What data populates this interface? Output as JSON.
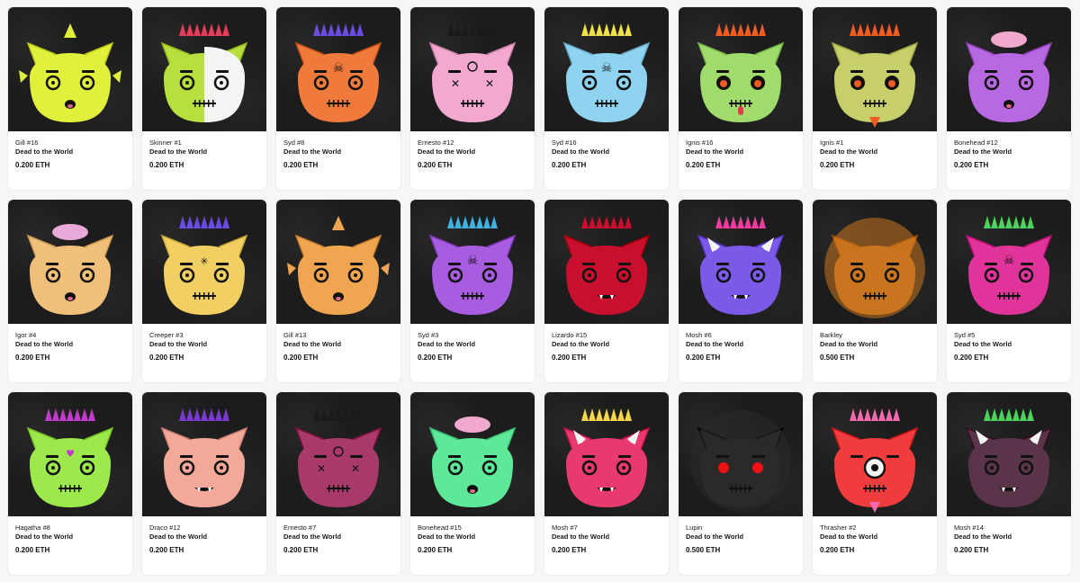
{
  "collection": "Dead to the World",
  "items": [
    {
      "name": "Gill #16",
      "collection": "Dead to the World",
      "price": "0.200 ETH",
      "face": "#e1f03a",
      "hair": "#e1f03a",
      "eye": "plain",
      "feature": "fish",
      "icon": "monster-face-icon"
    },
    {
      "name": "Skinner #1",
      "collection": "Dead to the World",
      "price": "0.200 ETH",
      "face": "#b7df3d",
      "hair": "#e23d5d",
      "eye": "plain",
      "feature": "skull-half",
      "icon": "monster-face-icon"
    },
    {
      "name": "Syd #8",
      "collection": "Dead to the World",
      "price": "0.200 ETH",
      "face": "#f07a3c",
      "hair": "#6b4be0",
      "eye": "plain",
      "feature": "crossbones",
      "icon": "monster-face-icon"
    },
    {
      "name": "Ernesto #12",
      "collection": "Dead to the World",
      "price": "0.200 ETH",
      "face": "#f2a8cf",
      "hair": "#1a1a1a",
      "eye": "x",
      "feature": "pentagram",
      "icon": "monster-face-icon"
    },
    {
      "name": "Syd #16",
      "collection": "Dead to the World",
      "price": "0.200 ETH",
      "face": "#8fd3f0",
      "hair": "#f0e04a",
      "eye": "plain",
      "feature": "crossbones",
      "icon": "monster-face-icon"
    },
    {
      "name": "Ignis #16",
      "collection": "Dead to the World",
      "price": "0.200 ETH",
      "face": "#9fdc6b",
      "hair": "#f05a23",
      "eye": "fire",
      "feature": "tongue",
      "icon": "monster-face-icon"
    },
    {
      "name": "Ignis #1",
      "collection": "Dead to the World",
      "price": "0.200 ETH",
      "face": "#c7cf6a",
      "hair": "#f05a23",
      "eye": "fire",
      "feature": "goatee",
      "icon": "monster-face-icon"
    },
    {
      "name": "Bonehead #12",
      "collection": "Dead to the World",
      "price": "0.200 ETH",
      "face": "#b868e0",
      "hair": "#f0a8cf",
      "eye": "plain",
      "feature": "brain",
      "icon": "monster-face-icon"
    },
    {
      "name": "Igor #4",
      "collection": "Dead to the World",
      "price": "0.200 ETH",
      "face": "#f0c07a",
      "hair": "#e8a8d8",
      "eye": "plain",
      "feature": "brain",
      "icon": "monster-face-icon"
    },
    {
      "name": "Creeper #3",
      "collection": "Dead to the World",
      "price": "0.200 ETH",
      "face": "#f2cf62",
      "hair": "#6b4be0",
      "eye": "plain",
      "feature": "spider",
      "icon": "monster-face-icon"
    },
    {
      "name": "Gill #13",
      "collection": "Dead to the World",
      "price": "0.200 ETH",
      "face": "#f0a550",
      "hair": "#f0a550",
      "eye": "plain",
      "feature": "fish",
      "icon": "monster-face-icon"
    },
    {
      "name": "Syd #3",
      "collection": "Dead to the World",
      "price": "0.200 ETH",
      "face": "#a85de0",
      "hair": "#3fb0e0",
      "eye": "plain",
      "feature": "crossbones",
      "icon": "monster-face-icon"
    },
    {
      "name": "Lizardo #15",
      "collection": "Dead to the World",
      "price": "0.200 ETH",
      "face": "#c8102e",
      "hair": "#c8102e",
      "eye": "plain",
      "feature": "fangs",
      "icon": "monster-face-icon"
    },
    {
      "name": "Mosh #6",
      "collection": "Dead to the World",
      "price": "0.200 ETH",
      "face": "#7a5ae6",
      "hair": "#f03ca0",
      "eye": "plain",
      "feature": "horns",
      "icon": "monster-face-icon"
    },
    {
      "name": "Barkley",
      "collection": "Dead to the World",
      "price": "0.500 ETH",
      "face": "#c9741e",
      "hair": "#c9741e",
      "eye": "plain",
      "feature": "furry",
      "icon": "monster-face-icon"
    },
    {
      "name": "Syd #5",
      "collection": "Dead to the World",
      "price": "0.200 ETH",
      "face": "#e0349a",
      "hair": "#4bd35e",
      "eye": "plain",
      "feature": "crossbones",
      "icon": "monster-face-icon"
    },
    {
      "name": "Hagatha #8",
      "collection": "Dead to the World",
      "price": "0.200 ETH",
      "face": "#9de84a",
      "hair": "#c23ad0",
      "eye": "plain",
      "feature": "heart",
      "icon": "monster-face-icon"
    },
    {
      "name": "Draco #12",
      "collection": "Dead to the World",
      "price": "0.200 ETH",
      "face": "#f4a89a",
      "hair": "#7a3ad0",
      "eye": "plain",
      "feature": "fangs",
      "icon": "monster-face-icon"
    },
    {
      "name": "Ernesto #7",
      "collection": "Dead to the World",
      "price": "0.200 ETH",
      "face": "#a83a6a",
      "hair": "#1a1a1a",
      "eye": "x",
      "feature": "pentagram",
      "icon": "monster-face-icon"
    },
    {
      "name": "Bonehead #15",
      "collection": "Dead to the World",
      "price": "0.200 ETH",
      "face": "#5ee89a",
      "hair": "#f0a8cf",
      "eye": "plain",
      "feature": "brain",
      "icon": "monster-face-icon"
    },
    {
      "name": "Mosh #7",
      "collection": "Dead to the World",
      "price": "0.200 ETH",
      "face": "#e83a6e",
      "hair": "#f0d84a",
      "eye": "plain",
      "feature": "horns",
      "icon": "monster-face-icon"
    },
    {
      "name": "Lupin",
      "collection": "Dead to the World",
      "price": "0.500 ETH",
      "face": "#2a2a2a",
      "hair": "#2a2a2a",
      "eye": "red",
      "feature": "furry",
      "icon": "monster-face-icon"
    },
    {
      "name": "Thrasher #2",
      "collection": "Dead to the World",
      "price": "0.200 ETH",
      "face": "#f03c3c",
      "hair": "#f06ab0",
      "eye": "cyclops",
      "feature": "goatee",
      "icon": "monster-face-icon"
    },
    {
      "name": "Mosh #14",
      "collection": "Dead to the World",
      "price": "0.200 ETH",
      "face": "#5a3448",
      "hair": "#4bd35e",
      "eye": "plain",
      "feature": "horns",
      "icon": "monster-face-icon"
    }
  ]
}
